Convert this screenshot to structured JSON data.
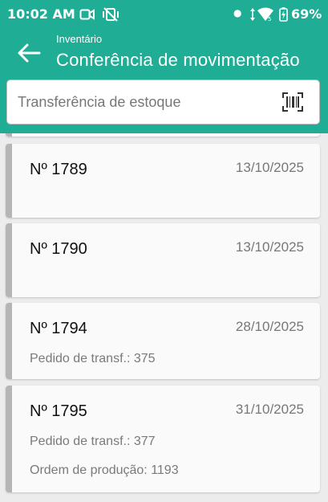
{
  "status_bar": {
    "time": "10:02 AM",
    "battery": "69%",
    "icons": [
      "screen-record-icon",
      "vibrate-icon",
      "wifi-icon",
      "signal-icon",
      "battery-icon"
    ]
  },
  "app_bar": {
    "subtitle": "Inventário",
    "title": "Conferência de movimentação",
    "color": "#20ad96"
  },
  "search": {
    "placeholder": "Transferência de estoque",
    "value": ""
  },
  "items": [
    {
      "number": "Nº 1789",
      "date": "13/10/2025"
    },
    {
      "number": "Nº 1790",
      "date": "13/10/2025"
    },
    {
      "number": "Nº 1794",
      "date": "28/10/2025",
      "transfer_order": "Pedido de transf.:  375"
    },
    {
      "number": "Nº 1795",
      "date": "31/10/2025",
      "transfer_order": "Pedido de transf.:  377",
      "production_order": "Ordem de produção: 1193"
    }
  ]
}
